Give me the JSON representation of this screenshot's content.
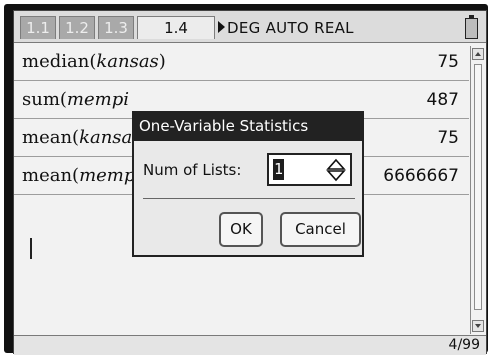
{
  "tabs": [
    {
      "label": "1.1",
      "active": false
    },
    {
      "label": "1.2",
      "active": false
    },
    {
      "label": "1.3",
      "active": false
    },
    {
      "label": "1.4",
      "active": true
    }
  ],
  "mode_label": "DEG AUTO REAL",
  "history": [
    {
      "func": "median(",
      "arg": "kansas",
      "close": ")",
      "result": "75"
    },
    {
      "func": "sum(",
      "arg": "mempi",
      "close": "",
      "result": "487"
    },
    {
      "func": "mean(",
      "arg": "kansa",
      "close": "",
      "result": "75"
    },
    {
      "func": "mean(",
      "arg": "memp",
      "close": "",
      "result": "6666667"
    }
  ],
  "dialog": {
    "title": "One-Variable Statistics",
    "field_label": "Num of Lists:",
    "field_value": "1",
    "ok_label": "OK",
    "cancel_label": "Cancel"
  },
  "status": {
    "page": "4/99"
  },
  "icons": {
    "spinner": "up-down-arrows-icon",
    "battery": "battery-icon"
  },
  "colors": {
    "active_tab": "#ececec",
    "inactive_tab": "#a9a9a9",
    "dialog_title_bg": "#222222"
  }
}
